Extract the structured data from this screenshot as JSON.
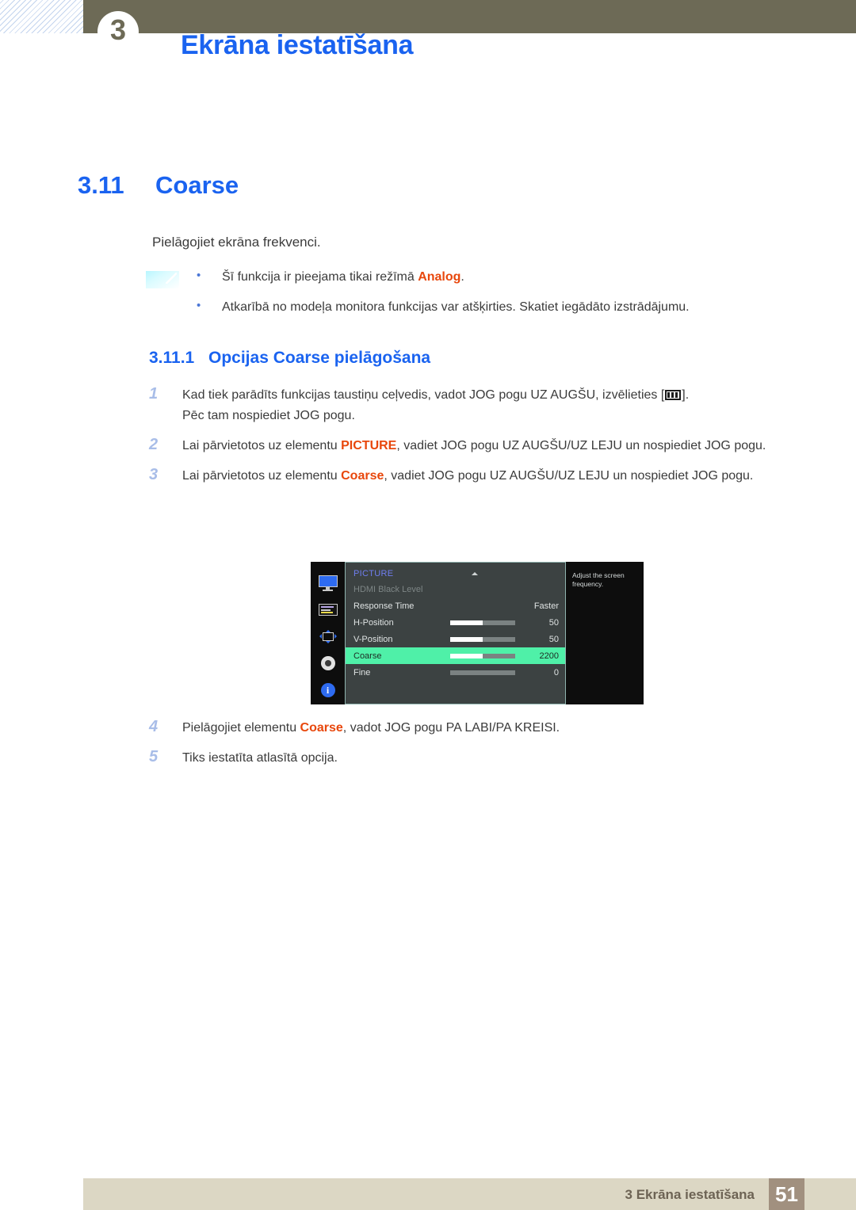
{
  "banner": {
    "chapter_number": "3",
    "title": "Ekrāna iestatīšana"
  },
  "section": {
    "number": "3.11",
    "title": "Coarse",
    "intro": "Pielāgojiet ekrāna frekvenci."
  },
  "note": {
    "icon": "note-icon",
    "items": [
      {
        "pre": "Šī funkcija ir pieejama tikai režīmā ",
        "hl": "Analog",
        "post": "."
      },
      {
        "pre": "Atkarībā no modeļa monitora funkcijas var atšķirties. Skatiet iegādāto izstrādājumu.",
        "hl": "",
        "post": ""
      }
    ]
  },
  "subsection": {
    "number": "3.11.1",
    "title": "Opcijas Coarse pielāgošana"
  },
  "steps": [
    {
      "num": "1",
      "line1_pre": "Kad tiek parādīts funkcijas taustiņu ceļvedis, vadot JOG pogu UZ AUGŠU, izvēlieties [",
      "line1_post": "].",
      "line2": "Pēc tam nospiediet JOG pogu.",
      "icon": "picture-menu-glyph"
    },
    {
      "num": "2",
      "pre": "Lai pārvietotos uz elementu ",
      "hl": "PICTURE",
      "post": ", vadiet JOG pogu UZ AUGŠU/UZ LEJU un nospiediet JOG pogu."
    },
    {
      "num": "3",
      "pre": "Lai pārvietotos uz elementu ",
      "hl": "Coarse",
      "post": ", vadiet JOG pogu UZ AUGŠU/UZ LEJU un nospiediet JOG pogu."
    }
  ],
  "steps_after": [
    {
      "num": "4",
      "pre": "Pielāgojiet elementu ",
      "hl": "Coarse",
      "post": ", vadot JOG pogu PA LABI/PA KREISI."
    },
    {
      "num": "5",
      "pre": "Tiks iestatīta atlasītā opcija.",
      "hl": "",
      "post": ""
    }
  ],
  "osd": {
    "sidebar_icons": [
      "monitor-icon",
      "osd-panel-icon",
      "position-arrows-icon",
      "gear-icon",
      "info-icon"
    ],
    "info_glyph": "i",
    "category": "PICTURE",
    "rows": [
      {
        "label": "HDMI Black Level",
        "value": "",
        "type": "dim",
        "slider": null
      },
      {
        "label": "Response Time",
        "value": "Faster",
        "type": "text",
        "slider": null
      },
      {
        "label": "H-Position",
        "value": "50",
        "type": "slider",
        "slider": 50
      },
      {
        "label": "V-Position",
        "value": "50",
        "type": "slider",
        "slider": 50
      },
      {
        "label": "Coarse",
        "value": "2200",
        "type": "selected",
        "slider": 50
      },
      {
        "label": "Fine",
        "value": "0",
        "type": "slider",
        "slider": 0
      }
    ],
    "help": "Adjust the screen frequency."
  },
  "footer": {
    "text": "3 Ekrāna iestatīšana",
    "page": "51"
  },
  "colors": {
    "accent_blue": "#1a63f0",
    "highlight_red": "#e8470c",
    "banner_olive": "#6d6a56",
    "footer_beige": "#dcd7c4",
    "page_box": "#a1907f",
    "osd_selected": "#4ff0a8"
  }
}
